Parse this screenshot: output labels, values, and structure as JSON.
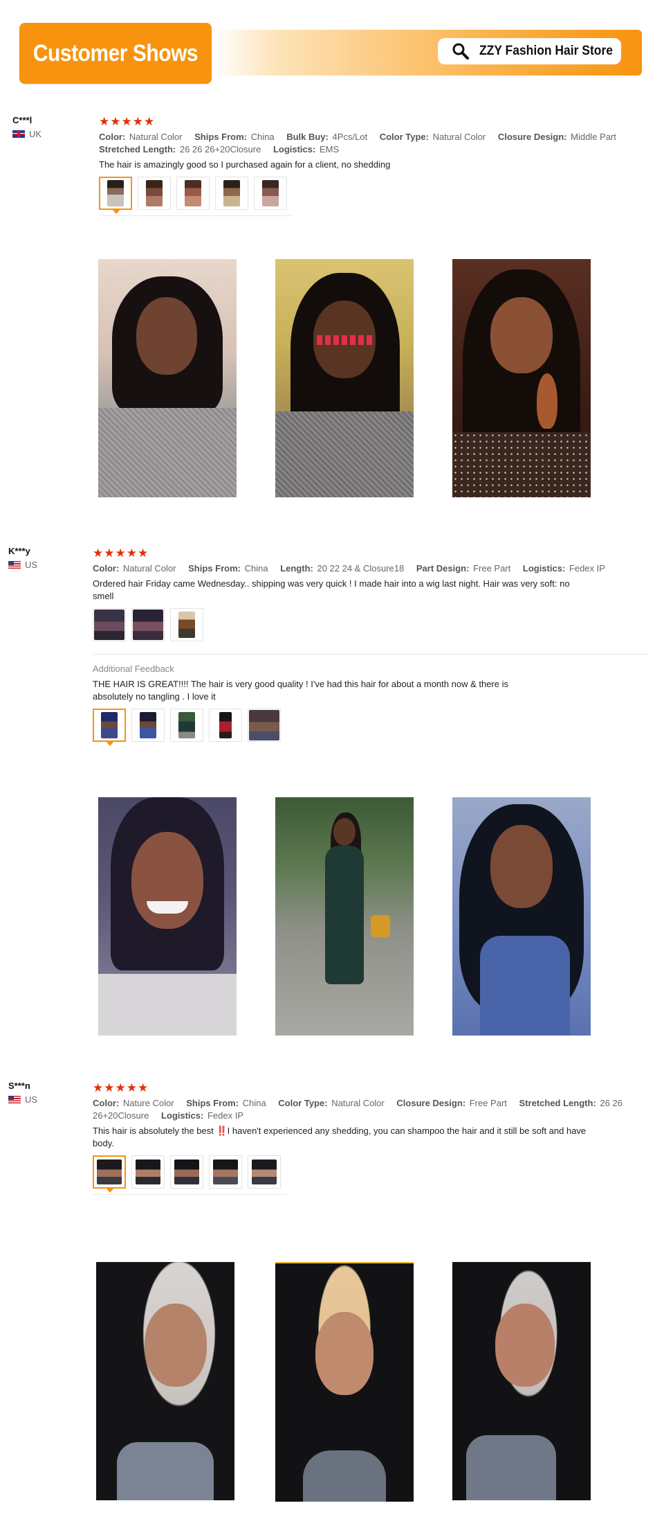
{
  "banner": {
    "title": "Customer Shows",
    "store_name": "ZZY Fashion Hair Store"
  },
  "reviews": [
    {
      "user": "C***l",
      "country": "UK",
      "stars": "★★★★★",
      "attributes": [
        {
          "k": "Color:",
          "v": "Natural Color"
        },
        {
          "k": "Ships From:",
          "v": "China"
        },
        {
          "k": "Bulk Buy:",
          "v": "4Pcs/Lot"
        },
        {
          "k": "Color Type:",
          "v": "Natural Color"
        },
        {
          "k": "Closure Design:",
          "v": "Middle Part"
        },
        {
          "k": "Stretched Length:",
          "v": "26 26 26+20Closure"
        },
        {
          "k": "Logistics:",
          "v": "EMS"
        }
      ],
      "text": "The hair is amazingly good so I purchased again for a client, no shedding"
    },
    {
      "user": "K***y",
      "country": "US",
      "stars": "★★★★★",
      "attributes": [
        {
          "k": "Color:",
          "v": "Natural Color"
        },
        {
          "k": "Ships From:",
          "v": "China"
        },
        {
          "k": "Length:",
          "v": "20 22 24 & Closure18"
        },
        {
          "k": "Part Design:",
          "v": "Free Part"
        },
        {
          "k": "Logistics:",
          "v": "Fedex IP"
        }
      ],
      "text": "Ordered hair Friday came Wednesday.. shipping was very quick ! I made hair into a wig last night. Hair was very soft: no smell",
      "additional_label": "Additional Feedback",
      "additional_text": "THE HAIR IS GREAT!!!! The hair is very good quality ! I've had this hair for about a month now & there is absolutely no tangling . I love it"
    },
    {
      "user": "S***n",
      "country": "US",
      "stars": "★★★★★",
      "attributes": [
        {
          "k": "Color:",
          "v": "Nature Color"
        },
        {
          "k": "Ships From:",
          "v": "China"
        },
        {
          "k": "Color Type:",
          "v": "Natural Color"
        },
        {
          "k": "Closure Design:",
          "v": "Free Part"
        },
        {
          "k": "Stretched Length:",
          "v": "26 26 26+20Closure"
        },
        {
          "k": "Logistics:",
          "v": "Fedex IP"
        }
      ],
      "text": "This hair is absolutely the best ‼️I haven't experienced any shedding, you can shampoo the hair and it still be soft and have body."
    }
  ],
  "colors": {
    "accent": "#f7930e",
    "star": "#e62e04"
  },
  "icons": [
    "search-icon",
    "flag-uk-icon",
    "flag-us-icon",
    "star-icon"
  ]
}
